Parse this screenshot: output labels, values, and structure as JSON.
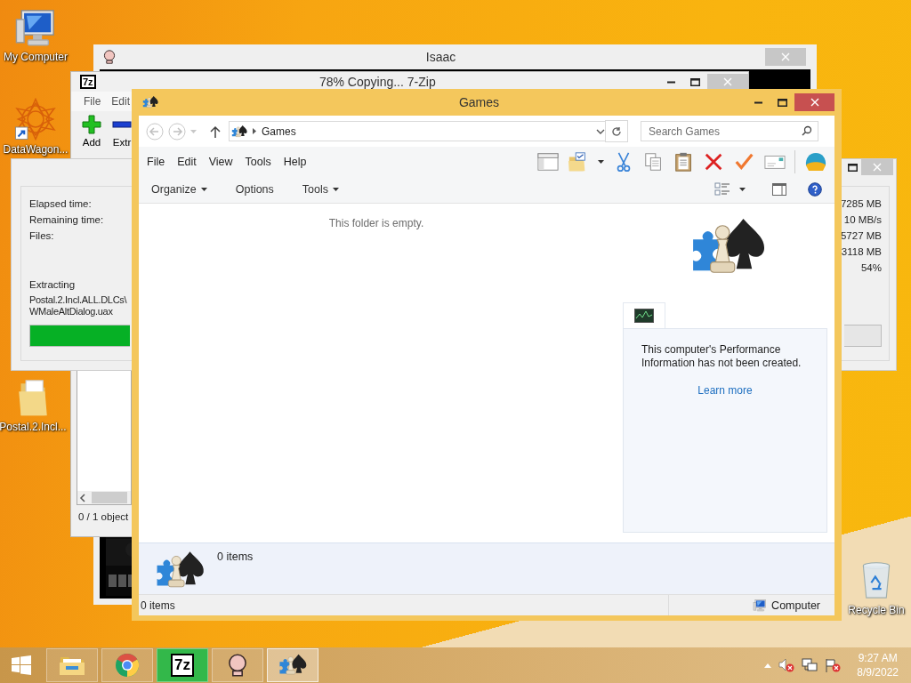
{
  "desktop_icons": [
    {
      "label": "My Computer",
      "kind": "computer"
    },
    {
      "label": "DataWagon...",
      "kind": "shortcut"
    },
    {
      "label": "Postal.2.Incl...",
      "kind": "folder"
    },
    {
      "label": "Recycle Bin",
      "kind": "bin"
    }
  ],
  "isaac_window": {
    "title": "Isaac"
  },
  "sevenzip_window": {
    "logo": "7z",
    "title": "78% Copying... 7-Zip",
    "menu": [
      "File",
      "Edit"
    ],
    "toolbar": [
      {
        "label": "Add",
        "kind": "add"
      },
      {
        "label": "Extr",
        "kind": "extract"
      }
    ],
    "status": "0 / 1 object"
  },
  "progress_dialog": {
    "labels": [
      "Elapsed time:",
      "Remaining time:",
      "Files:"
    ],
    "values": [
      "7285 MB",
      "10 MB/s",
      "5727 MB",
      "3118 MB",
      "54%"
    ],
    "operation": "Extracting",
    "file_lines": [
      "Postal.2.Incl.ALL.DLCs\\",
      "WMaleAltDialog.uax"
    ]
  },
  "games_window": {
    "title": "Games",
    "address": "Games",
    "search": {
      "placeholder": "Search Games"
    },
    "menu": [
      "File",
      "Edit",
      "View",
      "Tools",
      "Help"
    ],
    "commands": [
      {
        "label": "Organize",
        "dropdown": true
      },
      {
        "label": "Options",
        "dropdown": false
      },
      {
        "label": "Tools",
        "dropdown": true
      }
    ],
    "empty_message": "This folder is empty.",
    "performance": {
      "message": "This computer's Performance Information has not been created.",
      "link": "Learn more"
    },
    "details": {
      "count": "0 items"
    },
    "status_bar": {
      "items": "0 items",
      "location": "Computer"
    }
  },
  "taskbar": {
    "buttons": [
      {
        "kind": "explorer",
        "selected": false
      },
      {
        "kind": "chrome",
        "selected": false
      },
      {
        "kind": "sevenzip",
        "label": "7z",
        "selected": false
      },
      {
        "kind": "isaac",
        "selected": false
      },
      {
        "kind": "games",
        "selected": true
      }
    ],
    "clock": {
      "time": "9:27 AM",
      "date": "8/9/2022"
    }
  }
}
